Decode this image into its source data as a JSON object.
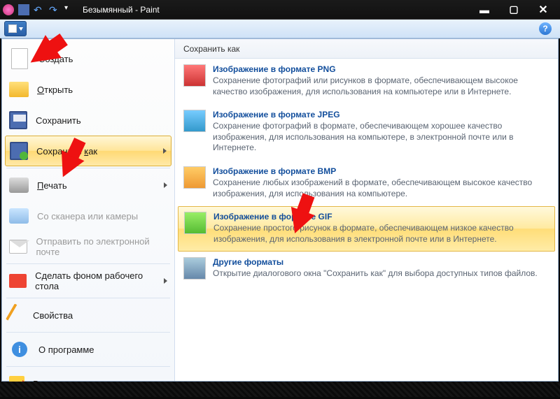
{
  "title": "Безымянный - Paint",
  "help": "?",
  "menu": {
    "create": "Создать",
    "open": "Открыть",
    "save": "Сохранить",
    "save_as": "Сохранить как",
    "print": "Печать",
    "scanner": "Со сканера или камеры",
    "email": "Отправить по электронной почте",
    "desktop": "Сделать фоном рабочего стола",
    "properties": "Свойства",
    "about": "О программе",
    "exit": "Выход"
  },
  "submenu": {
    "header": "Сохранить как",
    "png": {
      "title": "Изображение в формате PNG",
      "desc": "Сохранение фотографий или рисунков в формате, обеспечивающем высокое качество изображения, для использования на компьютере или в Интернете."
    },
    "jpeg": {
      "title": "Изображение в формате JPEG",
      "desc": "Сохранение фотографий в формате, обеспечивающем хорошее качество изображения, для использования на компьютере, в электронной почте или в Интернете."
    },
    "bmp": {
      "title": "Изображение в формате BMP",
      "desc": "Сохранение любых изображений в формате, обеспечивающем высокое качество изображения, для использования на компьютере."
    },
    "gif": {
      "title": "Изображение в формате GIF",
      "desc": "Сохранение простого рисунок в формате, обеспечивающем низкое качество изображения, для использования в электронной почте или в Интернете."
    },
    "other": {
      "title": "Другие форматы",
      "desc": "Открытие диалогового окна \"Сохранить как\" для выбора доступных типов файлов."
    }
  }
}
